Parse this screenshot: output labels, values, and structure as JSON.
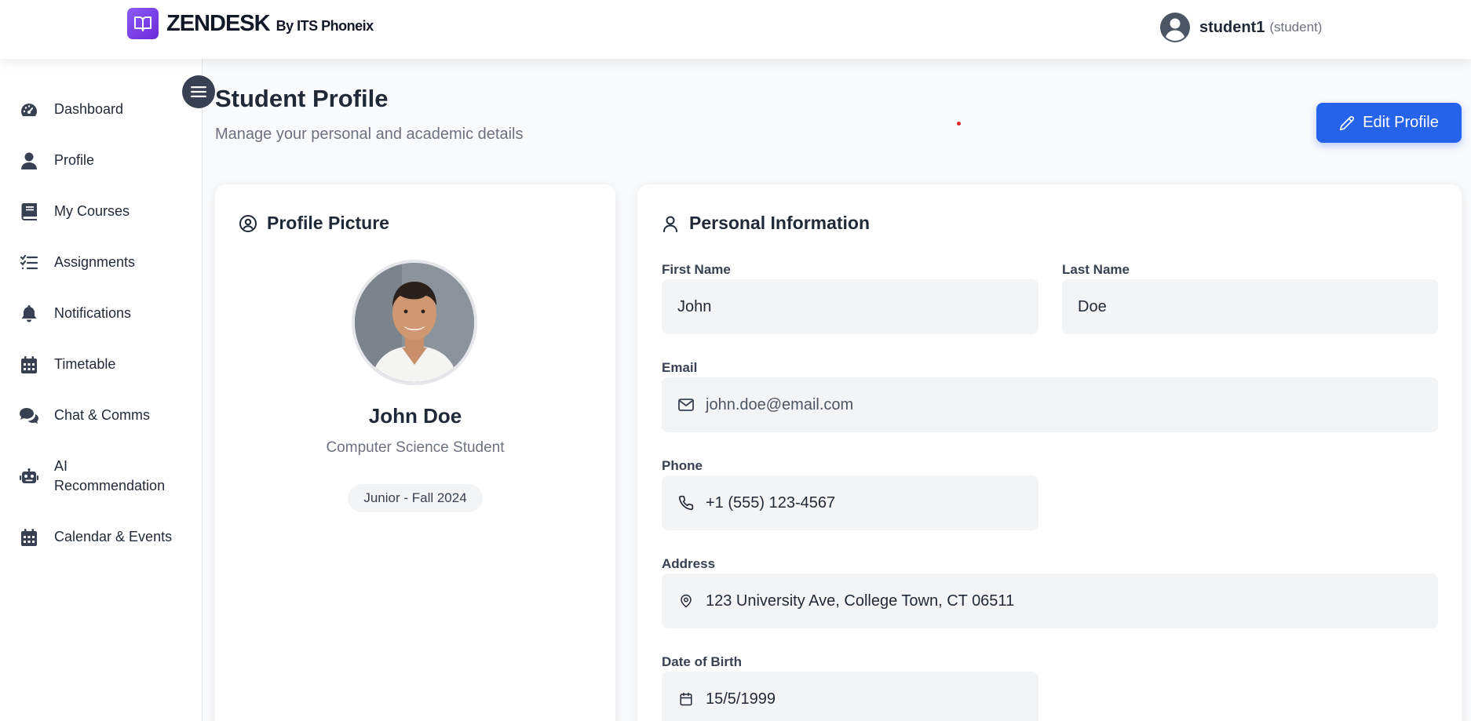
{
  "header": {
    "brand_name": "ZENDESK",
    "brand_sub": "By ITS Phoneix",
    "user_name": "student1",
    "user_role": "(student)"
  },
  "sidebar": {
    "items": [
      {
        "label": "Dashboard",
        "icon": "gauge-icon"
      },
      {
        "label": "Profile",
        "icon": "user-icon"
      },
      {
        "label": "My Courses",
        "icon": "book-icon"
      },
      {
        "label": "Assignments",
        "icon": "list-check-icon"
      },
      {
        "label": "Notifications",
        "icon": "bell-icon"
      },
      {
        "label": "Timetable",
        "icon": "calendar-icon"
      },
      {
        "label": "Chat & Comms",
        "icon": "comments-icon"
      },
      {
        "label": "AI\nRecommendation",
        "icon": "robot-icon"
      },
      {
        "label": "Calendar & Events",
        "icon": "calendar-icon"
      }
    ]
  },
  "page": {
    "title": "Student Profile",
    "subtitle": "Manage your personal and academic details",
    "edit_label": "Edit Profile"
  },
  "profile_card": {
    "title": "Profile Picture",
    "name": "John Doe",
    "major": "Computer Science Student",
    "badge": "Junior - Fall 2024"
  },
  "personal_info": {
    "title": "Personal Information",
    "first_name_label": "First Name",
    "first_name": "John",
    "last_name_label": "Last Name",
    "last_name": "Doe",
    "email_label": "Email",
    "email": "john.doe@email.com",
    "phone_label": "Phone",
    "phone": "+1 (555) 123-4567",
    "address_label": "Address",
    "address": "123 University Ave, College Town, CT 06511",
    "dob_label": "Date of Birth",
    "dob": "15/5/1999"
  },
  "colors": {
    "accent": "#2563eb",
    "brand": "#7c3aed",
    "sidebar_icon": "#374151"
  }
}
